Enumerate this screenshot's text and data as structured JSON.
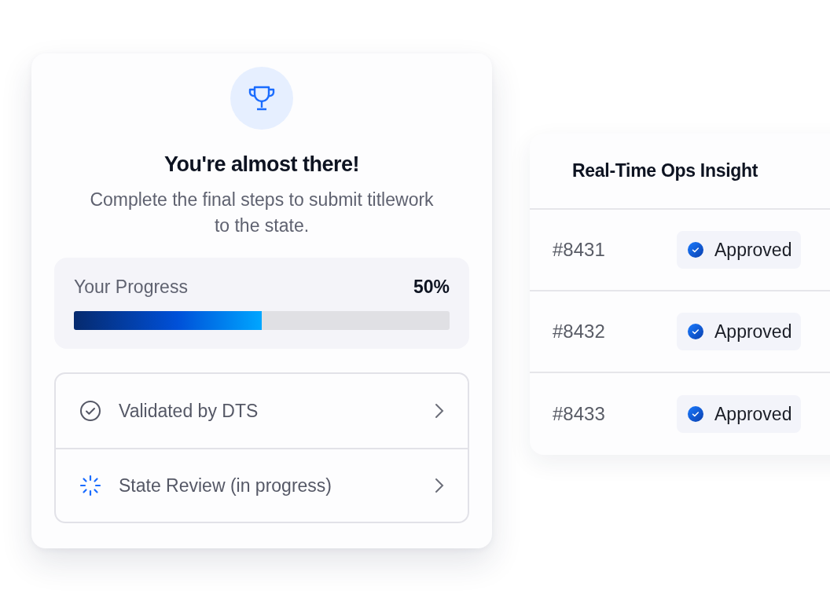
{
  "progress_card": {
    "title": "You're almost there!",
    "subtitle": "Complete the final steps to submit titlework to the state.",
    "progress": {
      "label": "Your Progress",
      "reading": "50%",
      "level": 0.5
    },
    "steps": [
      {
        "kind": "done",
        "label": "Validated by DTS"
      },
      {
        "kind": "in_progress",
        "label": "State Review (in progress)"
      }
    ]
  },
  "ops_panel": {
    "title": "Real-Time Ops Insight",
    "rows": [
      {
        "id": "#8431",
        "status": {
          "kind": "approved",
          "label": "Approved"
        }
      },
      {
        "id": "#8432",
        "status": {
          "kind": "approved",
          "label": "Approved"
        }
      },
      {
        "id": "#8433",
        "status": {
          "kind": "approved",
          "label": "Approved"
        }
      }
    ]
  }
}
